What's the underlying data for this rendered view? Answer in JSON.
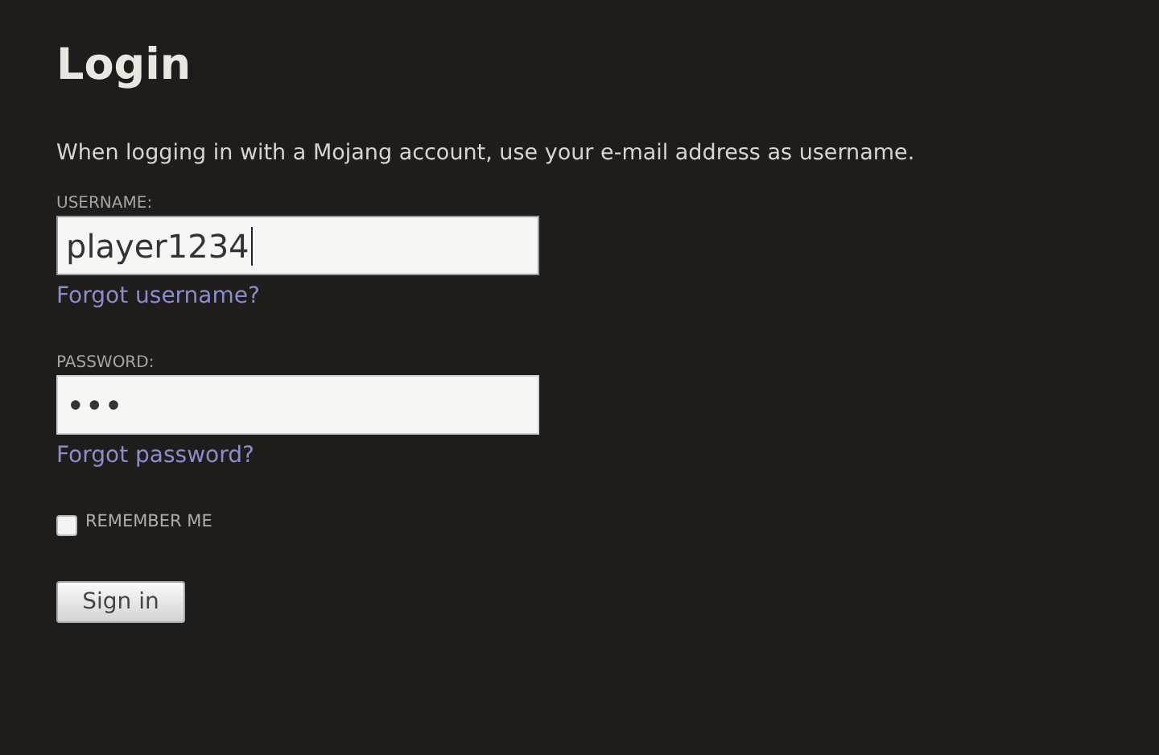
{
  "title": "Login",
  "description": "When logging in with a Mojang account, use your e-mail address as username.",
  "fields": [
    {
      "label": "USERNAME:",
      "value": "player1234",
      "focused": true,
      "link": "Forgot username?"
    },
    {
      "label": "PASSWORD:",
      "value": "•••",
      "focused": false,
      "link": "Forgot password?"
    }
  ],
  "remember": {
    "label": "REMEMBER ME",
    "checked": false
  },
  "button": "Sign in"
}
